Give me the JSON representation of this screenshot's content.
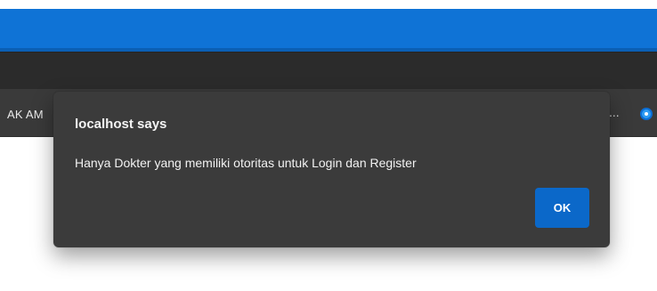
{
  "browser": {
    "bookmarks_left_text": "AK AM",
    "overflow_label": "..."
  },
  "dialog": {
    "title": "localhost says",
    "message": "Hanya Dokter yang memiliki otoritas untuk Login dan Register",
    "ok_label": "OK"
  },
  "colors": {
    "accent": "#0f73d6",
    "dialog_background": "#3b3b3b",
    "ok_button": "#0b68c9"
  }
}
